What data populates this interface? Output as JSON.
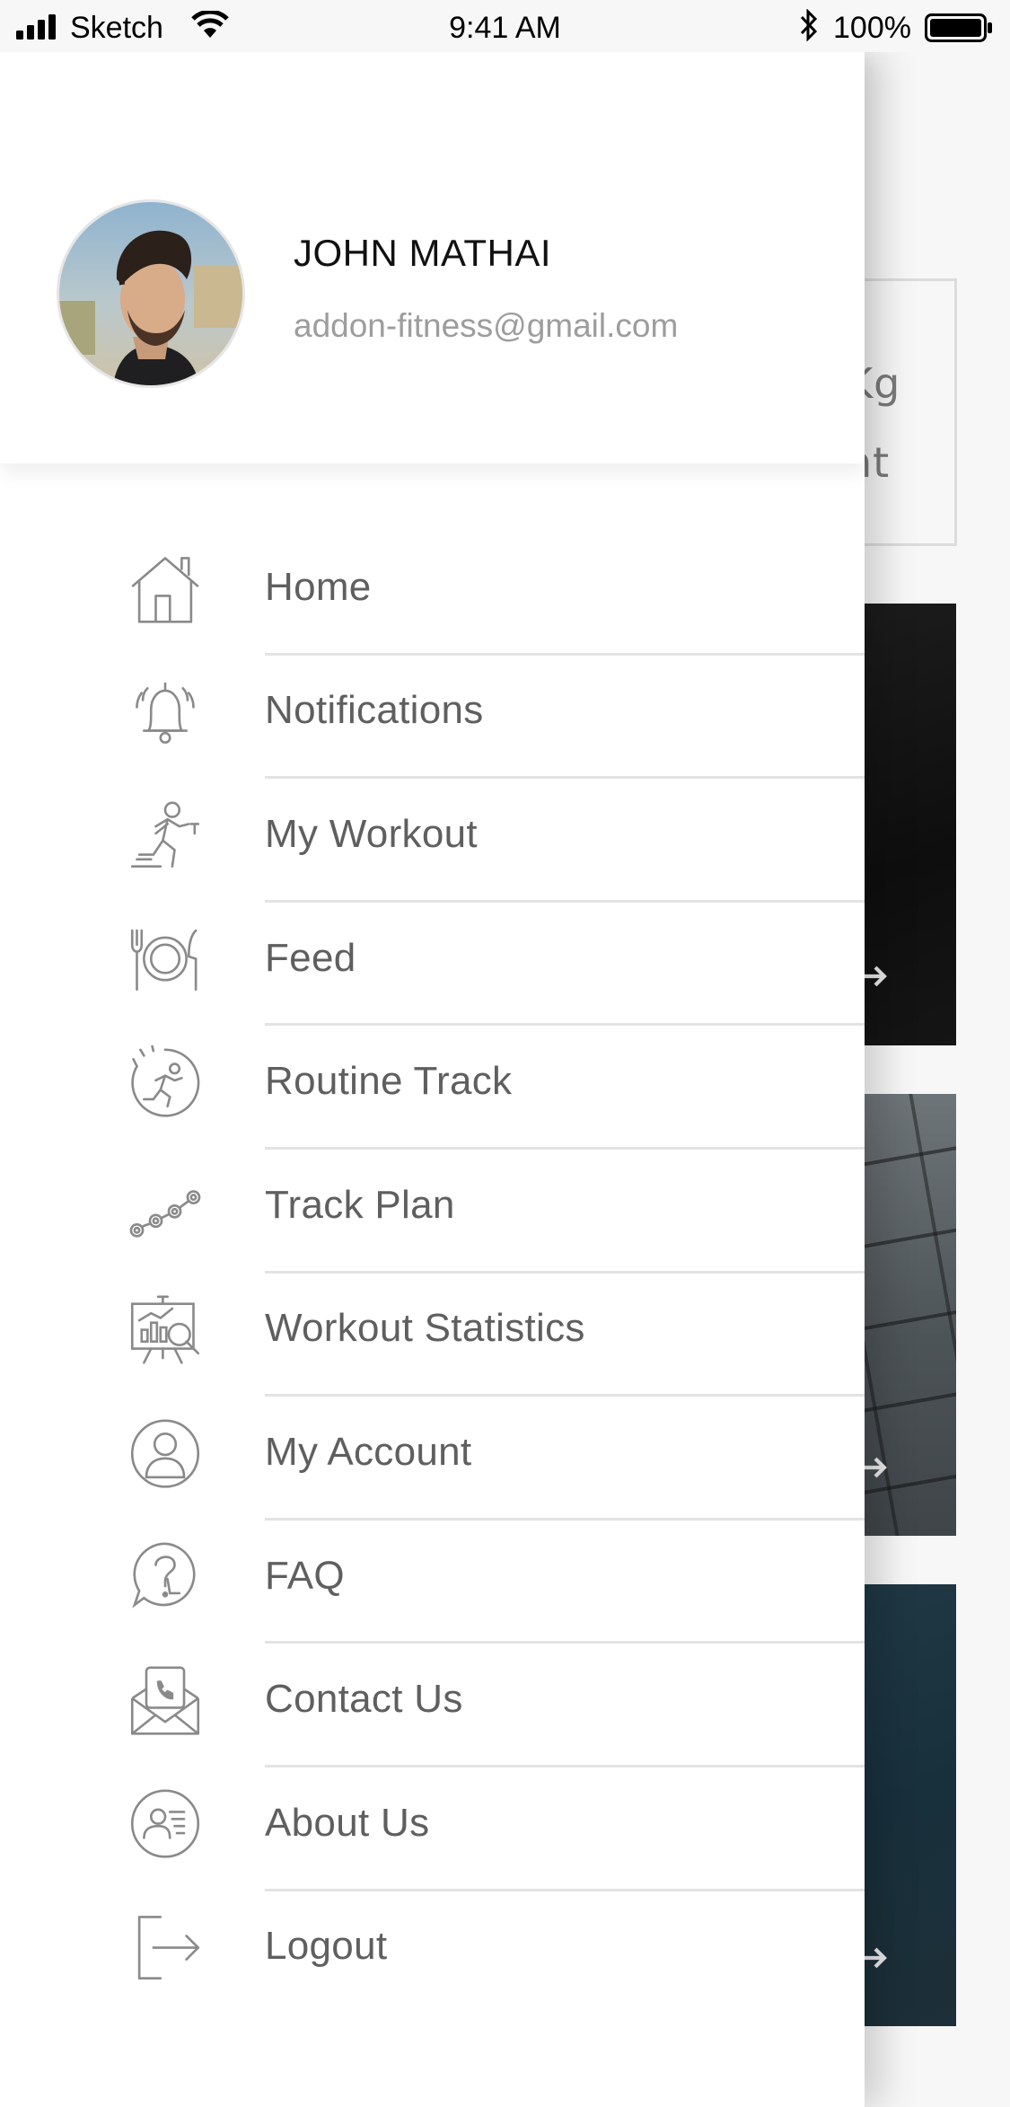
{
  "status_bar": {
    "carrier": "Sketch",
    "time": "9:41 AM",
    "battery": "100%"
  },
  "profile": {
    "name": "JOHN MATHAI",
    "email": "addon-fitness@gmail.com"
  },
  "menu": [
    {
      "label": "Home",
      "icon": "home-icon"
    },
    {
      "label": "Notifications",
      "icon": "bell-icon"
    },
    {
      "label": "My Workout",
      "icon": "runner-icon"
    },
    {
      "label": "Feed",
      "icon": "plate-cutlery-icon"
    },
    {
      "label": "Routine Track",
      "icon": "stopwatch-runner-icon"
    },
    {
      "label": "Track Plan",
      "icon": "track-nodes-icon"
    },
    {
      "label": "Workout Statistics",
      "icon": "chart-board-icon"
    },
    {
      "label": "My Account",
      "icon": "user-circle-icon"
    },
    {
      "label": "FAQ",
      "icon": "question-bubble-icon"
    },
    {
      "label": "Contact Us",
      "icon": "phone-envelope-icon"
    },
    {
      "label": "About Us",
      "icon": "id-card-circle-icon"
    },
    {
      "label": "Logout",
      "icon": "logout-icon"
    }
  ],
  "background": {
    "card_text_1": "Kg",
    "card_text_2": "nt"
  }
}
